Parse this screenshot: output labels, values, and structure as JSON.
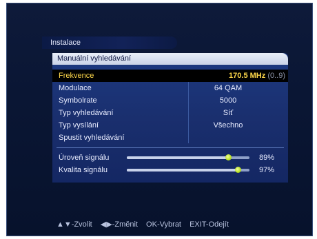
{
  "header": {
    "title": "Instalace"
  },
  "panel": {
    "title": "Manuální vyhledávání",
    "rows": [
      {
        "label": "Frekvence",
        "value": "170.5 MHz",
        "range": "(0..9)"
      },
      {
        "label": "Modulace",
        "value": "64 QAM"
      },
      {
        "label": "Symbolrate",
        "value": "5000"
      },
      {
        "label": "Typ vyhledávání",
        "value": "Síť"
      },
      {
        "label": "Typ vysílání",
        "value": "Všechno"
      },
      {
        "label": "Spustit vyhledávání",
        "value": ""
      }
    ],
    "signal": {
      "level_label": "Úroveň signálu",
      "level_pct": "89%",
      "level_value": 0.89,
      "quality_label": "Kvalita signálu",
      "quality_pct": "97%",
      "quality_value": 0.97,
      "accent": "#b8e020"
    }
  },
  "footer": {
    "select": "▲▼-Zvolit",
    "change": "◀▶-Změnit",
    "ok": "OK-Vybrat",
    "exit": "EXIT-Odejít"
  },
  "colors": {
    "selected_text": "#ffd84a",
    "panel": "#1d3a82",
    "header_bg": "#e9eef8"
  }
}
